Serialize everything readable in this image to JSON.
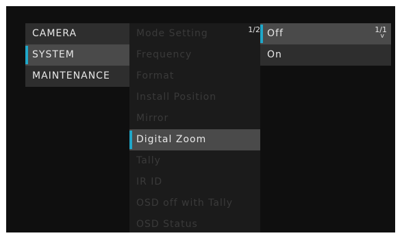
{
  "main_menu": {
    "items": [
      {
        "label": "CAMERA"
      },
      {
        "label": "SYSTEM"
      },
      {
        "label": "MAINTENANCE"
      }
    ],
    "selected_index": 1
  },
  "system_menu": {
    "page_indicator": "1/2",
    "items": [
      {
        "label": "Mode Setting"
      },
      {
        "label": "Frequency"
      },
      {
        "label": "Format"
      },
      {
        "label": "Install Position"
      },
      {
        "label": "Mirror"
      },
      {
        "label": "Digital Zoom"
      },
      {
        "label": "Tally"
      },
      {
        "label": "IR ID"
      },
      {
        "label": "OSD off with Tally"
      },
      {
        "label": "OSD Status"
      }
    ],
    "selected_index": 5
  },
  "option_menu": {
    "page_indicator": "1/1",
    "scroll_glyph": "v",
    "items": [
      {
        "label": "Off"
      },
      {
        "label": "On"
      }
    ],
    "selected_index": 0
  },
  "colors": {
    "accent": "#1fa7c9",
    "background": "#0f0f0f",
    "highlight": "#4a4a4a",
    "text": "#e8e8e8",
    "disabled_text": "#3a3a3a"
  }
}
